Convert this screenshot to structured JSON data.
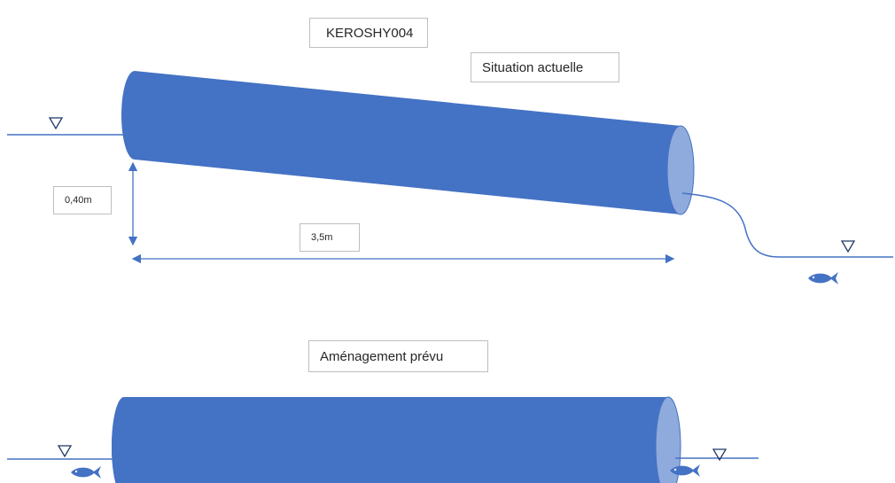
{
  "labels": {
    "culvert_id": "KEROSHY004",
    "current_state": "Situation actuelle",
    "drop_height": "0,40m",
    "culvert_length": "3,5m",
    "planned_work": "Aménagement prévu"
  },
  "colors": {
    "pipe_body": "#4472c4",
    "pipe_opening": "#8faadc",
    "water_line": "#4472c4",
    "fish": "#4472c4",
    "dimension_arrow": "#4472c4",
    "box_border": "#bfbfbf"
  },
  "icons": {
    "water_level": "inverted-triangle-icon",
    "fish": "fish-icon"
  }
}
